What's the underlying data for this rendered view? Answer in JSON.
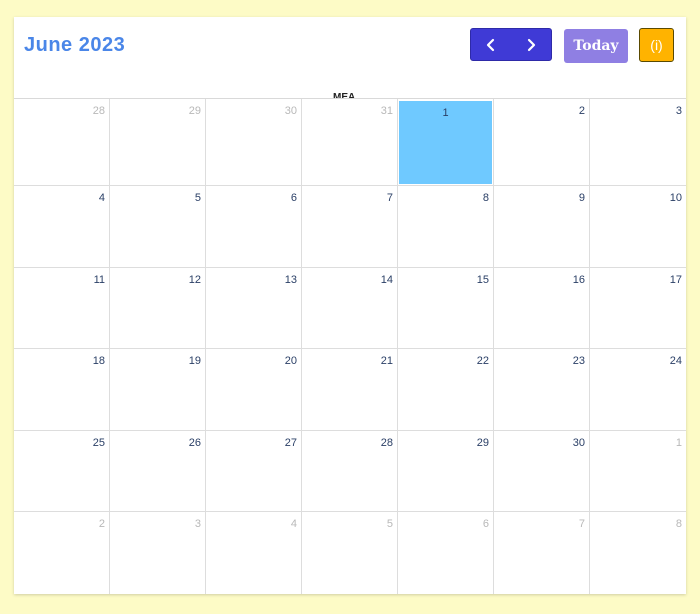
{
  "header": {
    "title": "June 2023",
    "today_label": "Today",
    "info_label": "(i)",
    "prev_icon": "chevron-left-icon",
    "next_icon": "chevron-right-icon"
  },
  "overlay_text": "MEA",
  "weeks": [
    [
      {
        "d": "28",
        "o": true
      },
      {
        "d": "29",
        "o": true
      },
      {
        "d": "30",
        "o": true
      },
      {
        "d": "31",
        "o": true
      },
      {
        "d": "1",
        "t": true
      },
      {
        "d": "2"
      },
      {
        "d": "3"
      }
    ],
    [
      {
        "d": "4"
      },
      {
        "d": "5"
      },
      {
        "d": "6"
      },
      {
        "d": "7"
      },
      {
        "d": "8"
      },
      {
        "d": "9"
      },
      {
        "d": "10"
      }
    ],
    [
      {
        "d": "11"
      },
      {
        "d": "12"
      },
      {
        "d": "13"
      },
      {
        "d": "14"
      },
      {
        "d": "15"
      },
      {
        "d": "16"
      },
      {
        "d": "17"
      }
    ],
    [
      {
        "d": "18"
      },
      {
        "d": "19"
      },
      {
        "d": "20"
      },
      {
        "d": "21"
      },
      {
        "d": "22"
      },
      {
        "d": "23"
      },
      {
        "d": "24"
      }
    ],
    [
      {
        "d": "25"
      },
      {
        "d": "26"
      },
      {
        "d": "27"
      },
      {
        "d": "28"
      },
      {
        "d": "29"
      },
      {
        "d": "30"
      },
      {
        "d": "1",
        "o": true
      }
    ],
    [
      {
        "d": "2",
        "o": true
      },
      {
        "d": "3",
        "o": true
      },
      {
        "d": "4",
        "o": true
      },
      {
        "d": "5",
        "o": true
      },
      {
        "d": "6",
        "o": true
      },
      {
        "d": "7",
        "o": true
      },
      {
        "d": "8",
        "o": true
      }
    ]
  ],
  "colors": {
    "title": "#4a86e8",
    "nav": "#3f3ad6",
    "today_button": "#8f7fe3",
    "info_button": "#ffb300",
    "today_cell": "#6fc9ff",
    "background": "#fdfbc6"
  }
}
